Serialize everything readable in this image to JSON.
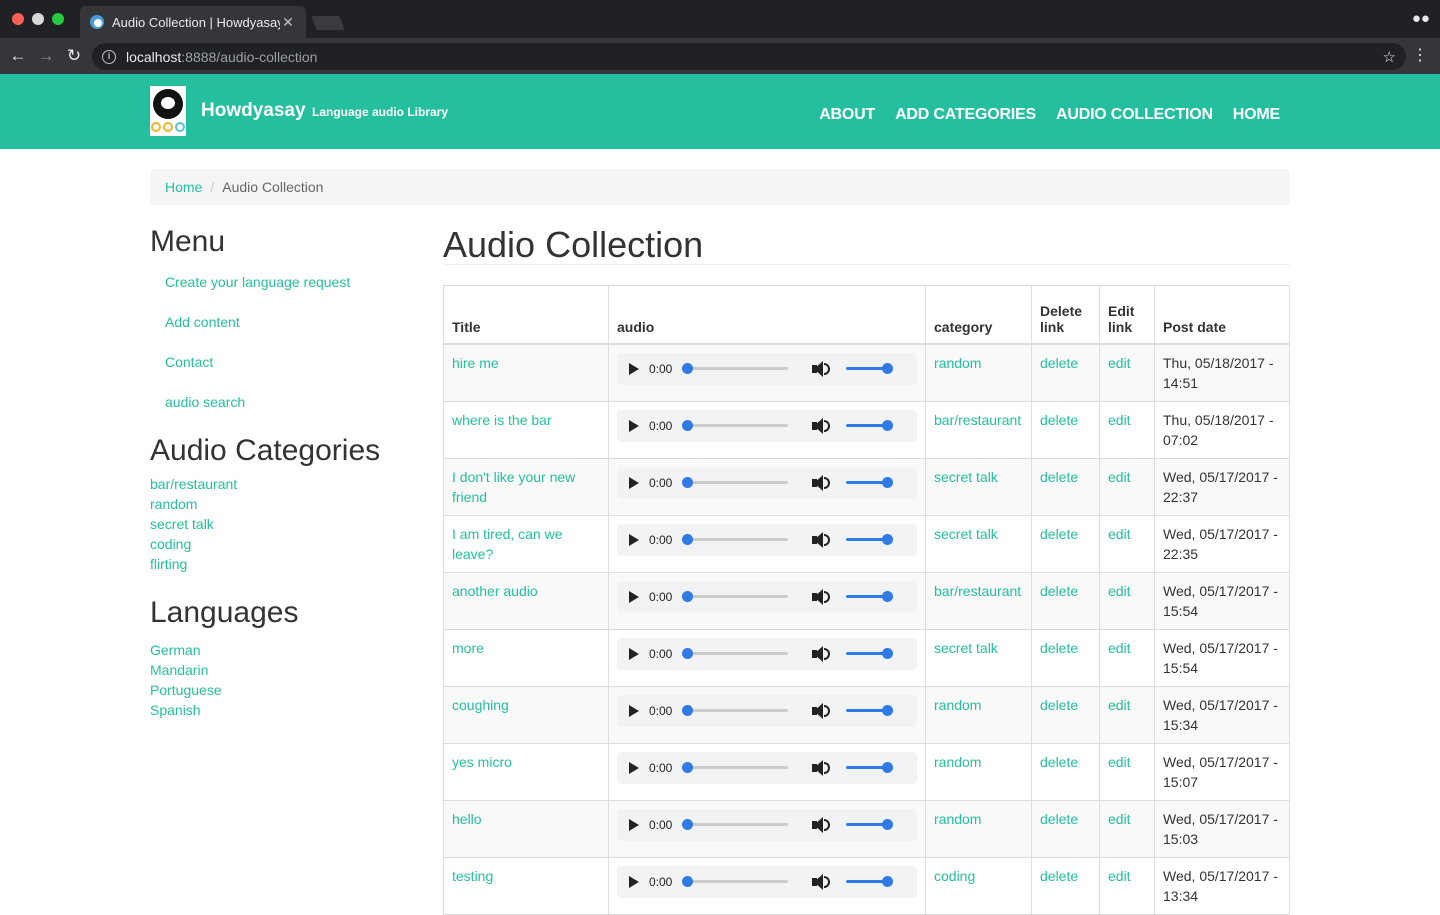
{
  "browser": {
    "tab_title": "Audio Collection | Howdyasay",
    "tab_close": "✕",
    "url_host": "localhost",
    "url_path": ":8888/audio-collection"
  },
  "site": {
    "name": "Howdyasay",
    "slogan": "Language audio Library",
    "logo_dot_colors": [
      "#f0b429",
      "#f0b429",
      "#5bc0de"
    ],
    "nav": [
      "ABOUT",
      "ADD CATEGORIES",
      "AUDIO COLLECTION",
      "HOME"
    ]
  },
  "breadcrumb": {
    "home": "Home",
    "separator": "/",
    "current": "Audio Collection"
  },
  "sidebar": {
    "menu_title": "Menu",
    "menu_items": [
      "Create your language request",
      "Add content",
      "Contact",
      "audio search"
    ],
    "categories_title": "Audio Categories",
    "categories": [
      "bar/restaurant",
      "random",
      "secret talk",
      "coding",
      "flirting"
    ],
    "languages_title": "Languages",
    "languages": [
      "German",
      "Mandarin",
      "Portuguese",
      "Spanish"
    ]
  },
  "content": {
    "title": "Audio Collection",
    "headers": {
      "title": "Title",
      "audio": "audio",
      "category": "category",
      "delete": "Delete link",
      "edit": "Edit link",
      "post_date": "Post date"
    },
    "player_time": "0:00",
    "rows": [
      {
        "title": "hire me",
        "category": "random",
        "delete": "delete",
        "edit": "edit",
        "post_date": "Thu, 05/18/2017 - 14:51"
      },
      {
        "title": "where is the bar",
        "category": "bar/restaurant",
        "delete": "delete",
        "edit": "edit",
        "post_date": "Thu, 05/18/2017 - 07:02"
      },
      {
        "title": "I don't like your new friend",
        "category": "secret talk",
        "delete": "delete",
        "edit": "edit",
        "post_date": "Wed, 05/17/2017 - 22:37"
      },
      {
        "title": "I am tired, can we leave?",
        "category": "secret talk",
        "delete": "delete",
        "edit": "edit",
        "post_date": "Wed, 05/17/2017 - 22:35"
      },
      {
        "title": "another audio",
        "category": "bar/restaurant",
        "delete": "delete",
        "edit": "edit",
        "post_date": "Wed, 05/17/2017 - 15:54"
      },
      {
        "title": "more",
        "category": "secret talk",
        "delete": "delete",
        "edit": "edit",
        "post_date": "Wed, 05/17/2017 - 15:54"
      },
      {
        "title": "coughing",
        "category": "random",
        "delete": "delete",
        "edit": "edit",
        "post_date": "Wed, 05/17/2017 - 15:34"
      },
      {
        "title": "yes micro",
        "category": "random",
        "delete": "delete",
        "edit": "edit",
        "post_date": "Wed, 05/17/2017 - 15:07"
      },
      {
        "title": "hello",
        "category": "random",
        "delete": "delete",
        "edit": "edit",
        "post_date": "Wed, 05/17/2017 - 15:03"
      },
      {
        "title": "testing",
        "category": "coding",
        "delete": "delete",
        "edit": "edit",
        "post_date": "Wed, 05/17/2017 - 13:34"
      }
    ]
  },
  "colors": {
    "brand": "#24bf9e",
    "link": "#24bf9e",
    "slider": "#2f7ae5"
  }
}
